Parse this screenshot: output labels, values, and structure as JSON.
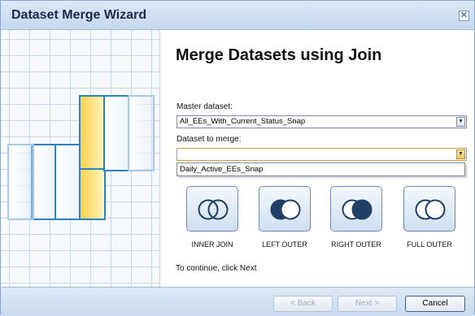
{
  "window": {
    "title": "Dataset Merge Wizard",
    "close_glyph": "✕",
    "close_icon": "close-icon"
  },
  "main": {
    "heading": "Merge Datasets using Join",
    "master_label": "Master dataset:",
    "master_value": "All_EEs_With_Current_Status_Snap",
    "merge_label": "Dataset to merge:",
    "merge_value": "",
    "merge_options": [
      "Daily_Active_EEs_Snap"
    ],
    "arrow_glyph": "▼",
    "joins": [
      {
        "label": "INNER JOIN",
        "icon": "inner-join-icon"
      },
      {
        "label": "LEFT OUTER",
        "icon": "left-outer-join-icon"
      },
      {
        "label": "RIGHT OUTER",
        "icon": "right-outer-join-icon"
      },
      {
        "label": "FULL OUTER",
        "icon": "full-outer-join-icon"
      }
    ],
    "footnote": "To continue, click Next"
  },
  "buttons": {
    "back": "< Back",
    "next": "Next >",
    "cancel": "Cancel"
  },
  "colors": {
    "accent_blue": "#2a84c2",
    "accent_yellow": "#ffd24d",
    "join_fill": "#1f3f66",
    "title_bar": "#c4d8ef"
  }
}
